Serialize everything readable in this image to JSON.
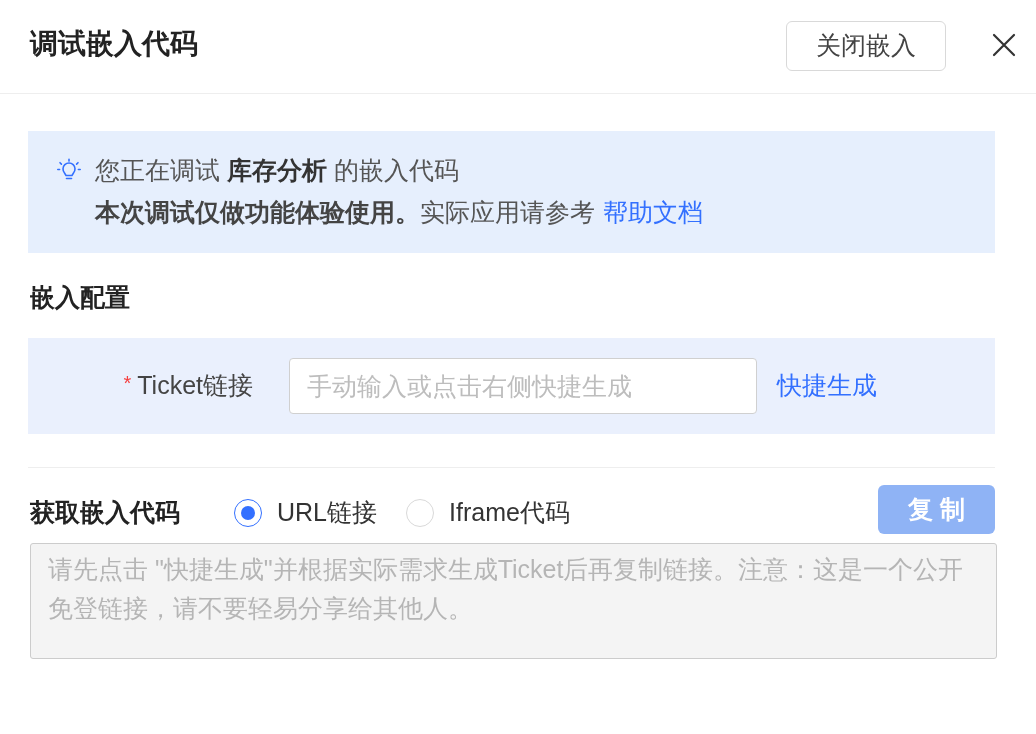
{
  "header": {
    "title": "调试嵌入代码",
    "close_embed_button": "关闭嵌入"
  },
  "notice": {
    "line_1": "您正在调试 **库存分析** 的嵌入代码",
    "line_2": "**本次调试仅做功能体验使用。**实际应用请参考",
    "link": "帮助文档"
  },
  "config": {
    "title": "嵌入配置",
    "fields": [
      {
        "required_mark": "*",
        "label": "Ticket链接",
        "placeholder": "手动输入或点击右侧快捷生成",
        "action": "快捷生成"
      }
    ]
  },
  "code": {
    "title": "获取嵌入代码",
    "formats": [
      {
        "label": "URL链接",
        "selected": true
      },
      {
        "label": "Iframe代码",
        "selected": false
      }
    ],
    "copy_button": {
      "label": "复 制",
      "disabled": true
    },
    "output": {
      "placeholder": "请先点击 \"快捷生成\"并根据实际需求生成Ticket后再复制链接。注意：这是一个公开免登链接，请不要轻易分享给其他人。",
      "disabled": true
    }
  }
}
